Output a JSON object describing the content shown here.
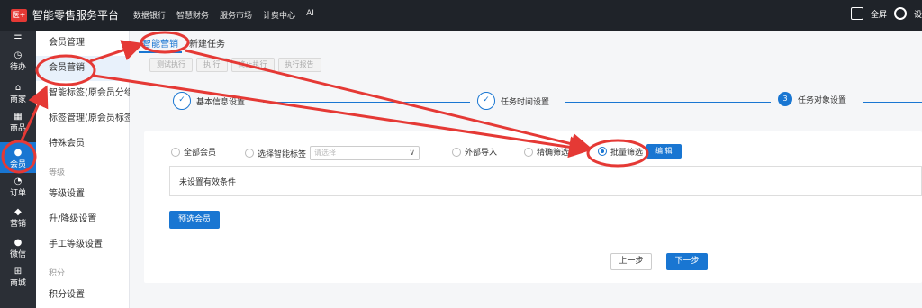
{
  "header": {
    "logo_text": "医+",
    "app_title": "智能零售服务平台",
    "nav": [
      "数据银行",
      "智慧财务",
      "服务市场",
      "计费中心",
      "AI"
    ],
    "fullscreen_label": "全屏",
    "settings_label": "设"
  },
  "leftbar": {
    "items": [
      {
        "icon": "☰",
        "label": ""
      },
      {
        "icon": "◷",
        "label": "待办"
      },
      {
        "icon": "⌂",
        "label": "商家"
      },
      {
        "icon": "▦",
        "label": "商品"
      },
      {
        "icon": "●",
        "label": "会员"
      },
      {
        "icon": "◔",
        "label": "订单"
      },
      {
        "icon": "◆",
        "label": "营销"
      },
      {
        "icon": "●",
        "label": "微信"
      },
      {
        "icon": "⊞",
        "label": "商城"
      }
    ]
  },
  "menu": {
    "items": [
      "会员管理",
      "会员营销",
      "智能标签(原会员分组)",
      "标签管理(原会员标签)",
      "特殊会员"
    ],
    "group_level": "等级",
    "level_items": [
      "等级设置",
      "升/降级设置",
      "手工等级设置"
    ],
    "group_points": "积分",
    "points_items": [
      "积分设置"
    ]
  },
  "tabs": [
    "智能营销",
    "新建任务"
  ],
  "toolbar": [
    "测试执行",
    "执 行",
    "终止执行",
    "执行报告"
  ],
  "steps": [
    {
      "label": "基本信息设置",
      "marker": "✓"
    },
    {
      "label": "任务时间设置",
      "marker": "✓"
    },
    {
      "label": "任务对象设置",
      "marker": "3"
    }
  ],
  "options": {
    "all_members": "全部会员",
    "smart_tag": "选择智能标签",
    "select_placeholder": "请选择",
    "external_import": "外部导入",
    "precise_filter": "精确筛选",
    "batch_filter": "批量筛选",
    "edit_button": "编 辑"
  },
  "condition_text": "未设置有效条件",
  "preselect_button": "预选会员",
  "prev_button": "上一步",
  "next_button": "下一步",
  "colors": {
    "accent": "#1976d2",
    "annotation": "#e53935",
    "topbar": "#1f2329"
  }
}
